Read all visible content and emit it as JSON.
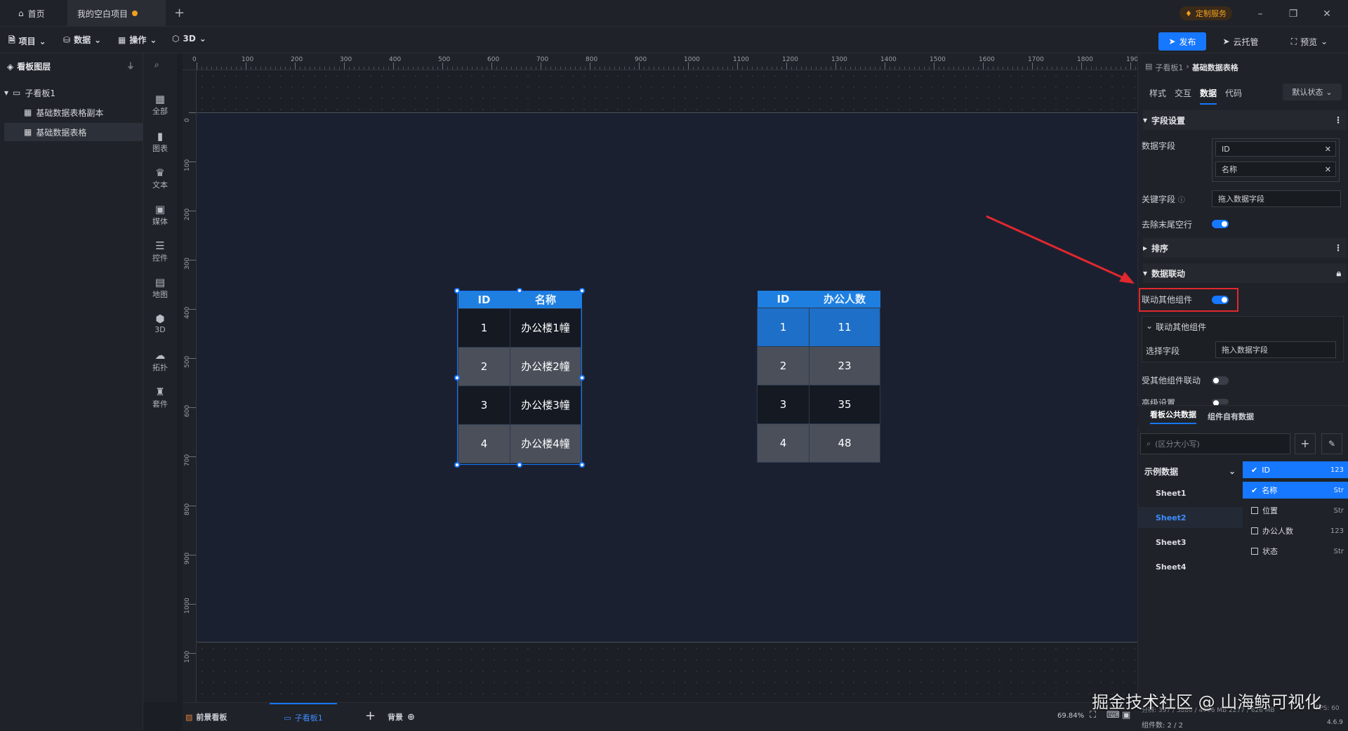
{
  "titlebar": {
    "home_tab": "首页",
    "project_tab": "我的空白项目",
    "add_tab": "+",
    "custom_service": "定制服务"
  },
  "menubar": {
    "items": [
      "项目",
      "数据",
      "操作",
      "3D"
    ],
    "publish": "发布",
    "cloud_host": "云托管",
    "preview": "预览"
  },
  "layers": {
    "title": "看板图层",
    "board": "子看板1",
    "items": [
      "基础数据表格副本",
      "基础数据表格"
    ]
  },
  "components": [
    "全部",
    "图表",
    "文本",
    "媒体",
    "控件",
    "地图",
    "3D",
    "拓扑",
    "套件"
  ],
  "ruler": {
    "h_ticks": [
      "0",
      "100",
      "200",
      "300",
      "400",
      "500",
      "600",
      "700",
      "800",
      "900",
      "1000",
      "1100",
      "1200",
      "1300",
      "1400",
      "1500",
      "1600",
      "1700",
      "1800",
      "1900"
    ],
    "v_ticks": [
      "0",
      "100",
      "200",
      "300",
      "400",
      "500",
      "600",
      "700",
      "800",
      "900",
      "1000",
      "100",
      "00"
    ]
  },
  "table1": {
    "headers": [
      "ID",
      "名称"
    ],
    "rows": [
      [
        "1",
        "办公楼1幢"
      ],
      [
        "2",
        "办公楼2幢"
      ],
      [
        "3",
        "办公楼3幢"
      ],
      [
        "4",
        "办公楼4幢"
      ]
    ]
  },
  "table2": {
    "headers": [
      "ID",
      "办公人数"
    ],
    "rows": [
      [
        "1",
        "11"
      ],
      [
        "2",
        "23"
      ],
      [
        "3",
        "35"
      ],
      [
        "4",
        "48"
      ]
    ]
  },
  "rightpanel": {
    "breadcrumb_parent": "子看板1",
    "breadcrumb_current": "基础数据表格",
    "tabs": [
      "样式",
      "交互",
      "数据",
      "代码"
    ],
    "state_select": "默认状态",
    "field_settings": "字段设置",
    "data_field_label": "数据字段",
    "data_fields": [
      "ID",
      "名称"
    ],
    "key_field_label": "关键字段",
    "key_field_placeholder": "拖入数据字段",
    "remove_trailing_label": "去除末尾空行",
    "sort_section": "排序",
    "linkage_section": "数据联动",
    "link_other_label": "联动其他组件",
    "link_other_sub": "联动其他组件",
    "select_field_label": "选择字段",
    "select_field_placeholder": "拖入数据字段",
    "receive_link_label": "受其他组件联动",
    "advanced_label": "高级设置",
    "data_tabs": [
      "看板公共数据",
      "组件自有数据"
    ],
    "search_placeholder": "(区分大小写)",
    "dataset_name": "示例数据",
    "sheets": [
      "Sheet1",
      "Sheet2",
      "Sheet3",
      "Sheet4"
    ],
    "fields": [
      {
        "name": "ID",
        "type": "123",
        "checked": true
      },
      {
        "name": "名称",
        "type": "Str",
        "checked": true
      },
      {
        "name": "位置",
        "type": "Str",
        "checked": false
      },
      {
        "name": "办公人数",
        "type": "123",
        "checked": false
      },
      {
        "name": "状态",
        "type": "Str",
        "checked": false
      }
    ]
  },
  "bottombar": {
    "foreground": "前景看板",
    "board_tab": "子看板1",
    "add": "+",
    "background": "背景",
    "zoom": "69.84%"
  },
  "statusbar": {
    "line1": "分辨: 397 / 3880 / 4096 MB  2277 / 626 MB",
    "fps": "FPS: 60",
    "component_count": "组件数: 2 / 2",
    "version": "4.6.9"
  },
  "watermark": "掘金技术社区 @ 山海鲸可视化",
  "colors": {
    "accent": "#1677ff",
    "table_header": "#1e7fe0",
    "highlight_box": "#e0282e",
    "arrow": "#e0282e"
  }
}
